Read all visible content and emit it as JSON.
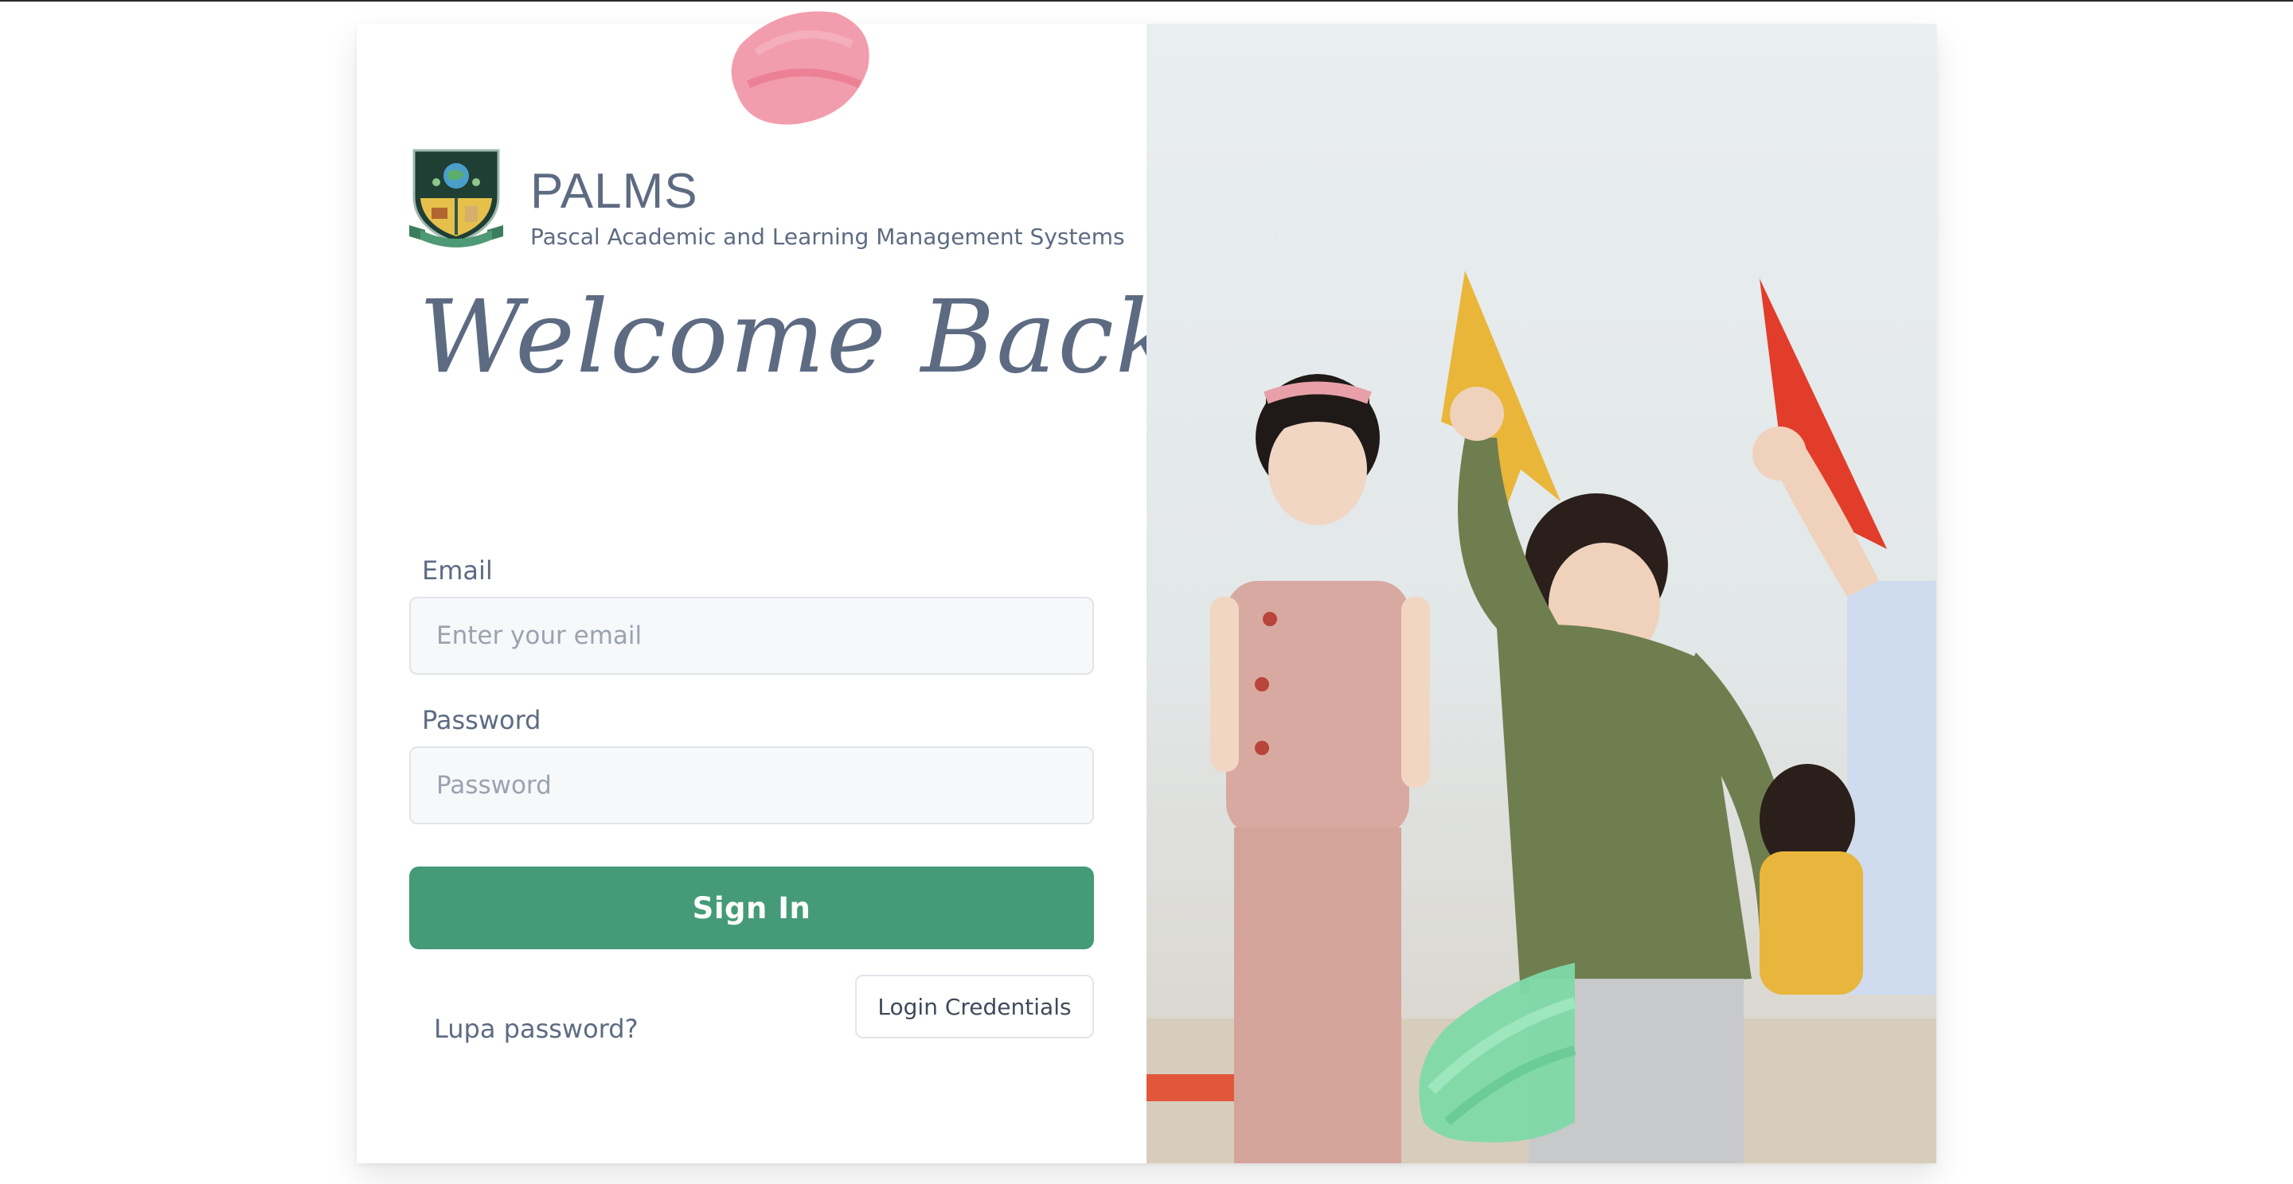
{
  "brand": {
    "name": "PALMS",
    "subtitle": "Pascal Academic and Learning Management Systems",
    "crest_icon": "school-crest-icon"
  },
  "heading": "Welcome Back",
  "form": {
    "email_label": "Email",
    "email_placeholder": "Enter your email",
    "password_label": "Password",
    "password_placeholder": "Password",
    "signin_label": "Sign In",
    "forgot_label": "Lupa password?",
    "credentials_label": "Login Credentials"
  },
  "colors": {
    "accent": "#459b78",
    "text": "#5d6b82",
    "pink_paint": "#f08ca0",
    "green_paint": "#7fd9a8"
  }
}
